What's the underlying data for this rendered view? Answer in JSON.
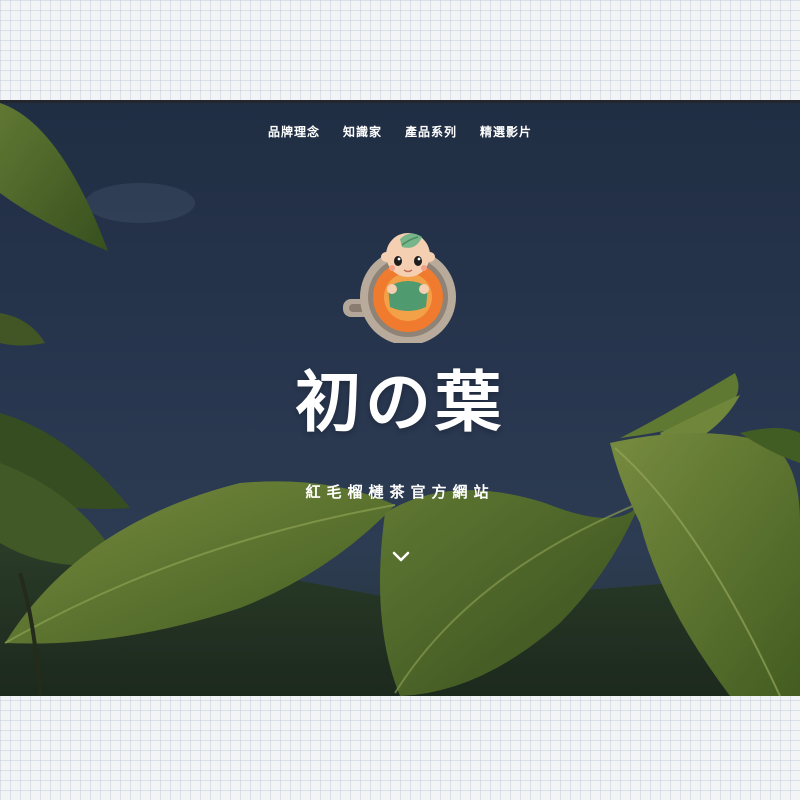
{
  "nav": {
    "items": [
      {
        "label": "品牌理念"
      },
      {
        "label": "知識家"
      },
      {
        "label": "產品系列"
      },
      {
        "label": "精選影片"
      }
    ]
  },
  "hero": {
    "title": "初の葉",
    "subtitle": "紅毛榴槤茶官方網站",
    "scroll_icon": "chevron-down-icon"
  },
  "mascot": {
    "icon": "baby-in-teacup-logo"
  },
  "colors": {
    "sky": "#243349",
    "leaf": "#5d7a2c",
    "text": "#ffffff",
    "tea": "#e8672a"
  }
}
